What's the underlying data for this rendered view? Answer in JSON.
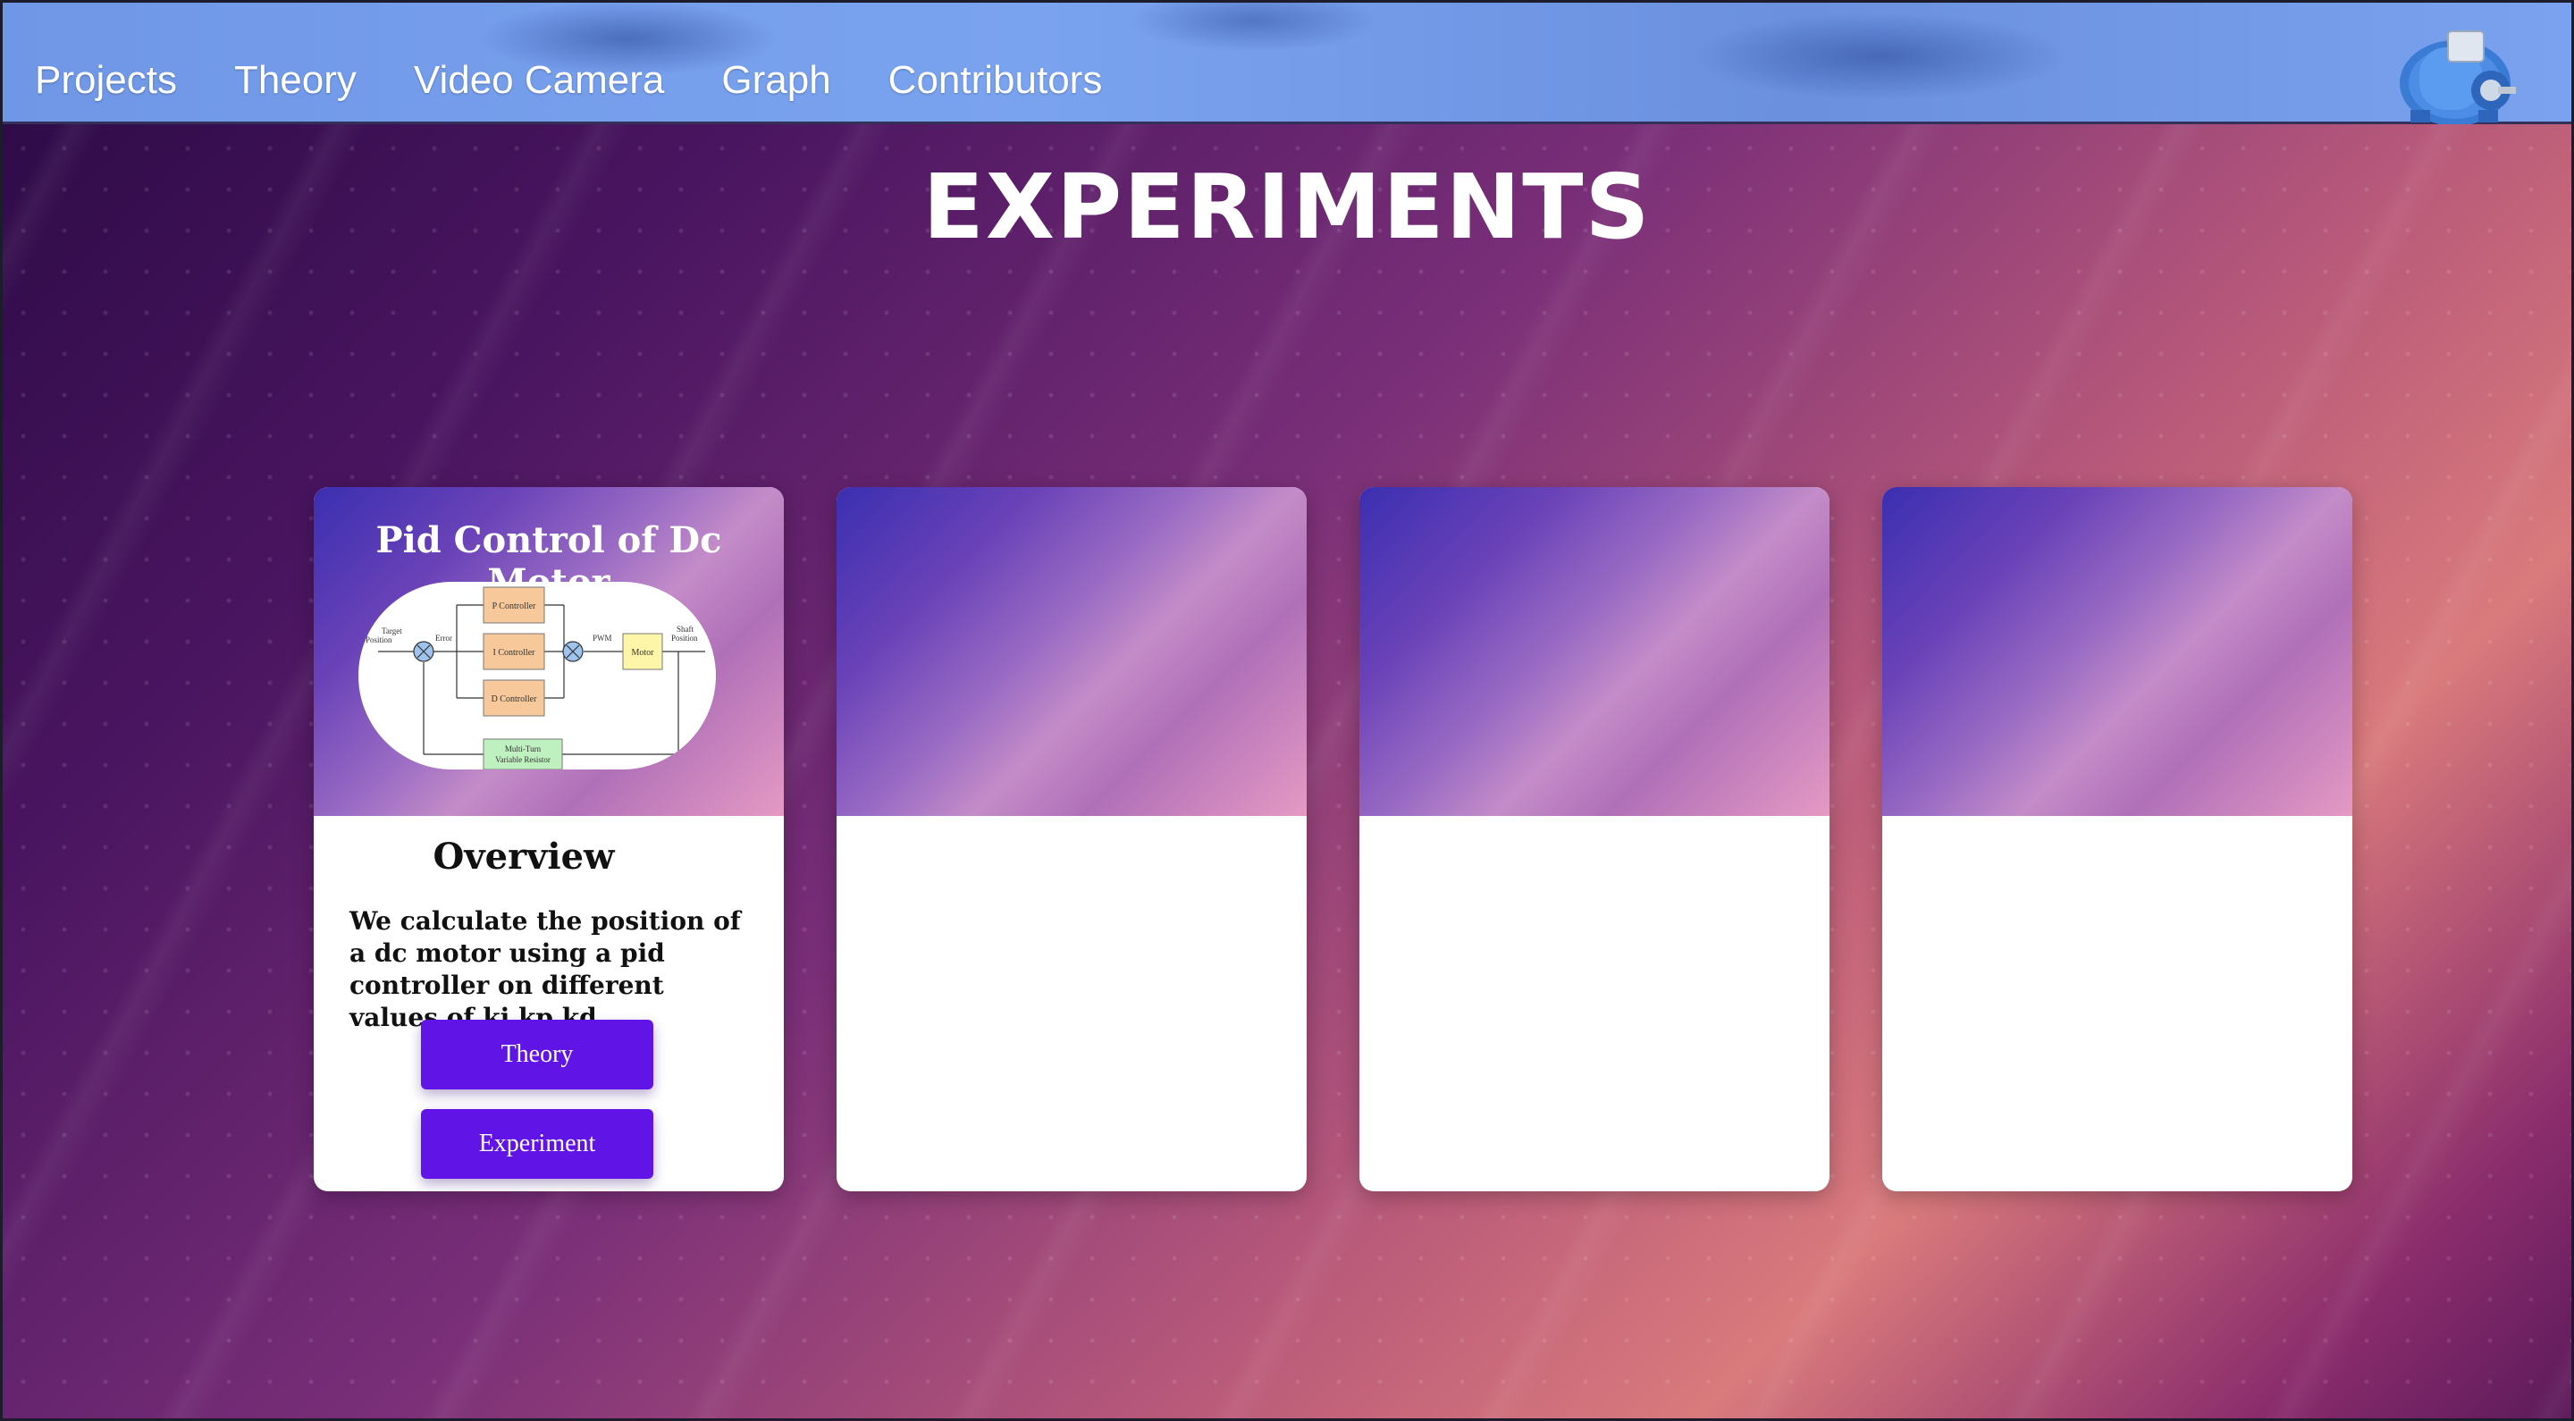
{
  "nav": {
    "links": [
      "Projects",
      "Theory",
      "Video Camera",
      "Graph",
      "Contributors"
    ]
  },
  "logo": {
    "icon": "motor-icon"
  },
  "page": {
    "title": "EXPERIMENTS"
  },
  "cards": [
    {
      "title": "Pid Control of Dc Motor",
      "diagram": {
        "target": [
          "Target",
          "Position"
        ],
        "error": "Error",
        "p": "P Controller",
        "i": "I Controller",
        "d": "D Controller",
        "pwm": "PWM",
        "motor": "Motor",
        "shaft": [
          "Shaft",
          "Position"
        ],
        "sensor": [
          "Multi-Turn",
          "Variable Resistor"
        ]
      },
      "overview_heading": "Overview",
      "description": "We calculate the position of a dc motor using a pid controller on different values of ki,kp,kd",
      "buttons": [
        "Theory",
        "Experiment"
      ]
    },
    {},
    {},
    {}
  ],
  "colors": {
    "button": "#6114e6",
    "navbar": "#7aa3ef"
  }
}
